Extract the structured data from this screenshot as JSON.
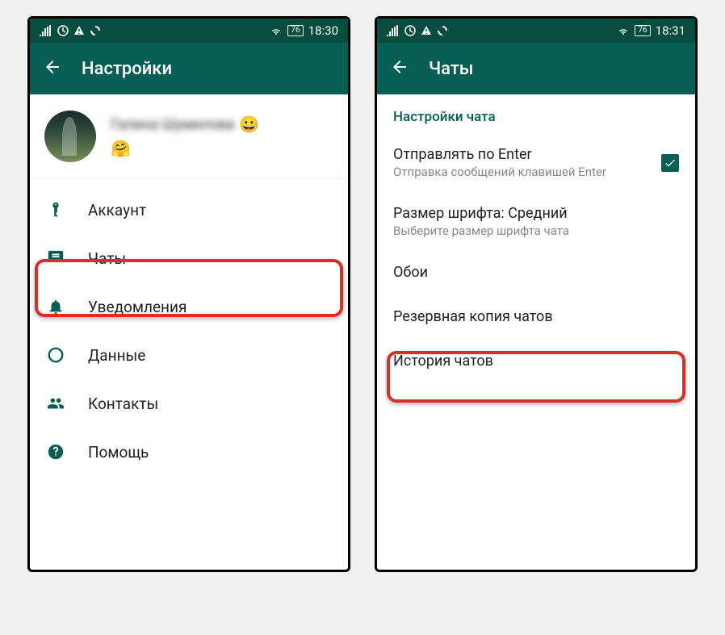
{
  "screen1": {
    "status": {
      "battery": "76",
      "time": "18:30"
    },
    "appbar": {
      "title": "Настройки"
    },
    "profile": {
      "name_blurred": "Галина Шумилова",
      "emoji1": "😀",
      "emoji2": "🤗"
    },
    "menu": {
      "account": "Аккаунт",
      "chats": "Чаты",
      "notifications": "Уведомления",
      "data": "Данные",
      "contacts": "Контакты",
      "help": "Помощь"
    }
  },
  "screen2": {
    "status": {
      "battery": "76",
      "time": "18:31"
    },
    "appbar": {
      "title": "Чаты"
    },
    "section_title": "Настройки чата",
    "enter_send": {
      "title": "Отправлять по Enter",
      "subtitle": "Отправка сообщений клавишей Enter"
    },
    "font_size": {
      "title": "Размер шрифта: Средний",
      "subtitle": "Выберите размер шрифта чата"
    },
    "wallpaper": "Обои",
    "backup": "Резервная копия чатов",
    "history": "История чатов"
  }
}
